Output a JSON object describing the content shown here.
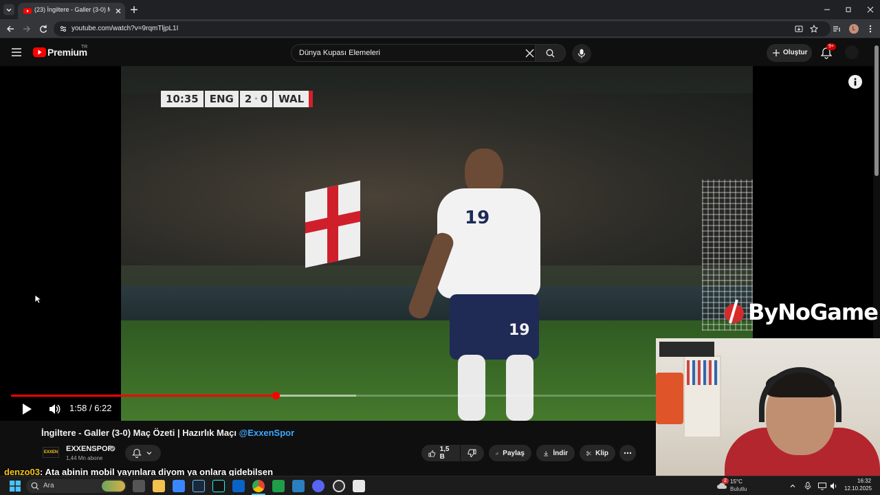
{
  "browser": {
    "tab_title": "(23) İngiltere - Galler (3-0) Maç",
    "url": "youtube.com/watch?v=9rqmTljpL1I",
    "profile_initial": "L"
  },
  "youtube": {
    "logo_text": "Premium",
    "region": "TR",
    "search_value": "Dünya Kupası Elemeleri",
    "create_label": "Oluştur",
    "notifications_badge": "9+"
  },
  "player": {
    "current_time": "1:58",
    "duration": "6:22",
    "time_separator": "/",
    "played_fraction": 0.41,
    "buffered_fraction": 0.535,
    "watermark": "ByNoGame",
    "scoreboard": {
      "clock": "10:35",
      "home": "ENG",
      "home_score": "2",
      "away_score": "0",
      "away": "WAL"
    },
    "jersey_number": "19"
  },
  "video": {
    "title": "İngiltere - Galler (3-0) Maç Özeti | Hazırlık Maçı",
    "title_mention": "@ExxenSpor",
    "channel_name": "EXXENSPOR",
    "channel_logo_text": "EXXEN",
    "subscribers": "1,44 Mn abone",
    "likes": "1,5 B",
    "share_label": "Paylaş",
    "download_label": "İndir",
    "clip_label": "Klip"
  },
  "chat": {
    "username": "denzo03",
    "message": ": Ata abinin mobil yayınlara diyom ya onlara gidebilsen"
  },
  "taskbar": {
    "search_placeholder": "Ara",
    "weather_temp": "15°C",
    "weather_desc": "Bulutlu",
    "weather_badge": "2",
    "time": "16:32",
    "date": "12.10.2025"
  },
  "colors": {
    "youtube_red": "#ff0000",
    "background": "#0f0f0f",
    "mention_blue": "#3ea6ff",
    "chat_name": "#f5c518"
  }
}
